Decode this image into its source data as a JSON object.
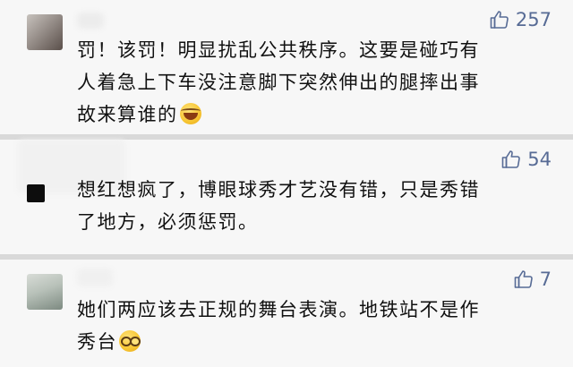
{
  "comments": [
    {
      "likes": "257",
      "lines": [
        "罚！该罚！明显扰乱公共秩序。这要是碰巧有",
        "人着急上下车没注意脚下突然伸出的腿摔出事",
        "故来算谁的"
      ],
      "emoji": "laughing-crying-emoji"
    },
    {
      "likes": "54",
      "lines": [
        "想红想疯了，博眼球秀才艺没有错，只是秀错",
        "了地方，必须惩罚。"
      ],
      "emoji": ""
    },
    {
      "likes": "7",
      "lines": [
        "她们两应该去正规的舞台表演。地铁站不是作",
        "秀台"
      ],
      "emoji": "nerd-face-emoji"
    }
  ],
  "icons": {
    "like": "thumbs-up-icon"
  },
  "colors": {
    "like_accent": "#576b95",
    "card_bg": "#f7f7f7",
    "divider": "#d9d9d9"
  }
}
